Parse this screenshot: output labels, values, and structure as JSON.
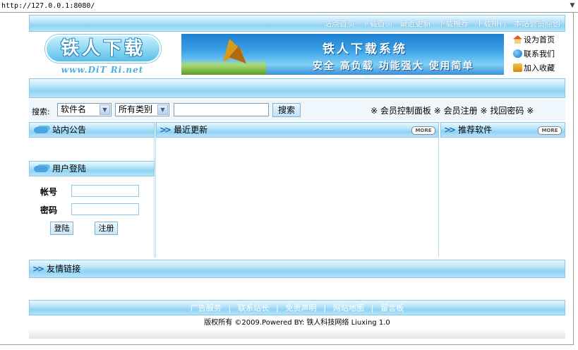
{
  "browser": {
    "url": "http://127.0.0.1:8080/"
  },
  "topnav": {
    "items": [
      "站点首页",
      "下载首页",
      "最近更新",
      "下载推荐",
      "下载排行",
      "本站会员原创"
    ]
  },
  "logo": {
    "main": "铁人下载",
    "url": "www.DiT Ri.net"
  },
  "banner": {
    "title": "铁人下载系统",
    "subtitle": "安全 高负载 功能强大 使用简单"
  },
  "quick_links": {
    "home": "设为首页",
    "contact": "联系我们",
    "favorite": "加入收藏"
  },
  "search": {
    "label": "搜索:",
    "type_selected": "软件名",
    "category_selected": "所有类别",
    "query": "",
    "button": "搜索"
  },
  "member_links": {
    "mark": "※",
    "control_panel": "会员控制面板",
    "register": "会员注册",
    "recover": "找回密码"
  },
  "sections": {
    "notice": "站内公告",
    "login": "用户登陆",
    "latest": "最近更新",
    "recommended": "推荐软件",
    "more": "MORE",
    "links": "友情链接"
  },
  "login": {
    "username_label": "帐号",
    "password_label": "密码",
    "username": "",
    "password": "",
    "login_button": "登陆",
    "register_button": "注册"
  },
  "footer": {
    "links": [
      "广告服务",
      "联系站长",
      "免责声明",
      "网站地图",
      "留言板"
    ],
    "separator": "|",
    "copyright": "版权所有 ©2009.Powered BY: 铁人科技网络 Liuxing 1.0"
  },
  "colors": {
    "sky_bar": "#8fd3f3",
    "accent_blue": "#1f6fb0",
    "border": "#86c9ea"
  }
}
